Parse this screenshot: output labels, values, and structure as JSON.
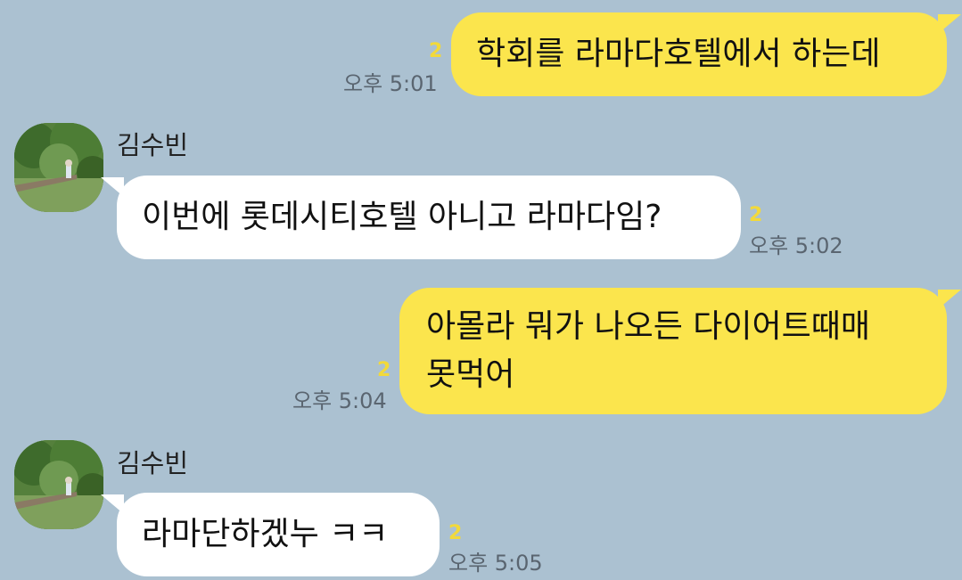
{
  "messages": [
    {
      "text": "학회를 라마다호텔에서 하는데",
      "unread": "2",
      "time": "오후 5:01"
    },
    {
      "sender": "김수빈",
      "text": "이번에 롯데시티호텔 아니고 라마다임?",
      "unread": "2",
      "time": "오후 5:02"
    },
    {
      "text_line1": "아몰라 뭐가 나오든 다이어트때매",
      "text_line2": "못먹어",
      "unread": "2",
      "time": "오후 5:04"
    },
    {
      "sender": "김수빈",
      "text": "라마단하겠누 ㅋㅋ",
      "unread": "2",
      "time": "오후 5:05"
    }
  ],
  "colors": {
    "background": "#abc1d1",
    "my_bubble": "#fbe54d",
    "their_bubble": "#ffffff",
    "unread": "#f2d93a"
  },
  "icons": {
    "avatar": "profile-photo-forest"
  }
}
